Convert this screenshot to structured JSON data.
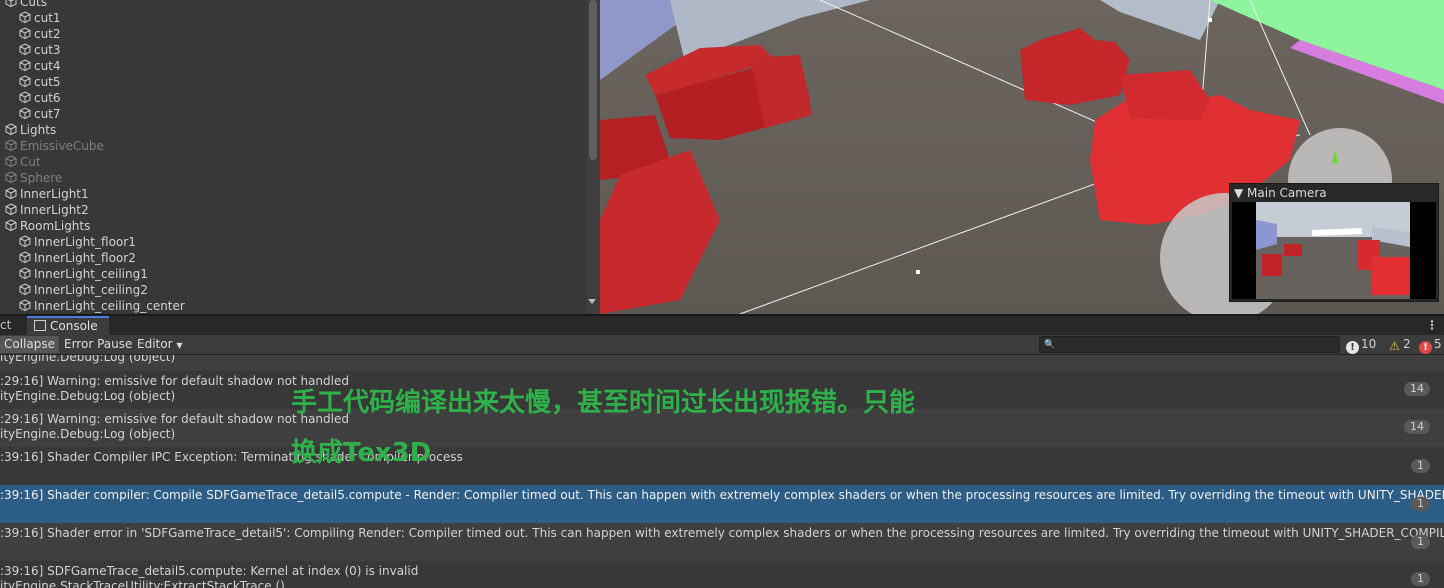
{
  "hierarchy": {
    "items": [
      {
        "label": "Cuts",
        "indent": 0,
        "dim": false
      },
      {
        "label": "cut1",
        "indent": 1,
        "dim": false
      },
      {
        "label": "cut2",
        "indent": 1,
        "dim": false
      },
      {
        "label": "cut3",
        "indent": 1,
        "dim": false
      },
      {
        "label": "cut4",
        "indent": 1,
        "dim": false
      },
      {
        "label": "cut5",
        "indent": 1,
        "dim": false
      },
      {
        "label": "cut6",
        "indent": 1,
        "dim": false
      },
      {
        "label": "cut7",
        "indent": 1,
        "dim": false
      },
      {
        "label": "Lights",
        "indent": 0,
        "dim": false
      },
      {
        "label": "EmissiveCube",
        "indent": 0,
        "dim": true
      },
      {
        "label": "Cut",
        "indent": 0,
        "dim": true
      },
      {
        "label": "Sphere",
        "indent": 0,
        "dim": true
      },
      {
        "label": "InnerLight1",
        "indent": 0,
        "dim": false
      },
      {
        "label": "InnerLight2",
        "indent": 0,
        "dim": false
      },
      {
        "label": "RoomLights",
        "indent": 0,
        "dim": false
      },
      {
        "label": "InnerLight_floor1",
        "indent": 1,
        "dim": false
      },
      {
        "label": "InnerLight_floor2",
        "indent": 1,
        "dim": false
      },
      {
        "label": "InnerLight_ceiling1",
        "indent": 1,
        "dim": false
      },
      {
        "label": "InnerLight_ceiling2",
        "indent": 1,
        "dim": false
      },
      {
        "label": "InnerLight_ceiling_center",
        "indent": 1,
        "dim": false
      }
    ]
  },
  "scene": {
    "camera_preview_title": "Main Camera"
  },
  "console": {
    "left_tab_label": "ct",
    "tab_label": "Console",
    "menu_glyph": "⋮",
    "toolbar": {
      "collapse": "Collapse",
      "error_pause": "Error Pause",
      "editor": "Editor"
    },
    "counts": {
      "info": "10",
      "warning": "2",
      "error": "5"
    },
    "entries": [
      {
        "line1": "ityEngine.Debug:Log (object)",
        "line2": "",
        "count": "",
        "style": "b"
      },
      {
        "line1": ":29:16] Warning: emissive for default shadow not handled",
        "line2": "ityEngine.Debug:Log (object)",
        "count": "14",
        "style": "a"
      },
      {
        "line1": ":29:16] Warning: emissive for default shadow not handled",
        "line2": "ityEngine.Debug:Log (object)",
        "count": "14",
        "style": "b"
      },
      {
        "line1": ":39:16] Shader Compiler IPC Exception: Terminating shader compiler process",
        "line2": "",
        "count": "1",
        "style": "a"
      },
      {
        "line1": ":39:16] Shader compiler: Compile SDFGameTrace_detail5.compute - Render: Compiler timed out. This can happen with extremely complex shaders or when the processing resources are limited. Try overriding the timeout with UNITY_SHADER_COMPILER_TASK_TIMEOUT_MINUTES",
        "line2": "",
        "count": "1",
        "style": "sel"
      },
      {
        "line1": ":39:16] Shader error in 'SDFGameTrace_detail5': Compiling Render: Compiler timed out. This can happen with extremely complex shaders or when the processing resources are limited. Try overriding the timeout with UNITY_SHADER_COMPILER_TASK_TIMEOUT_MINUTES",
        "line2": "",
        "count": "1",
        "style": "b"
      },
      {
        "line1": ":39:16] SDFGameTrace_detail5.compute: Kernel at index (0) is invalid",
        "line2": "ityEngine.StackTraceUtility:ExtractStackTrace ()",
        "count": "1",
        "style": "a"
      }
    ]
  },
  "overlay": {
    "line1": "手工代码编译出来太慢，甚至时间过长出现报错。只能",
    "line2": "换成Tex3D",
    "color": "#2fb14a"
  }
}
